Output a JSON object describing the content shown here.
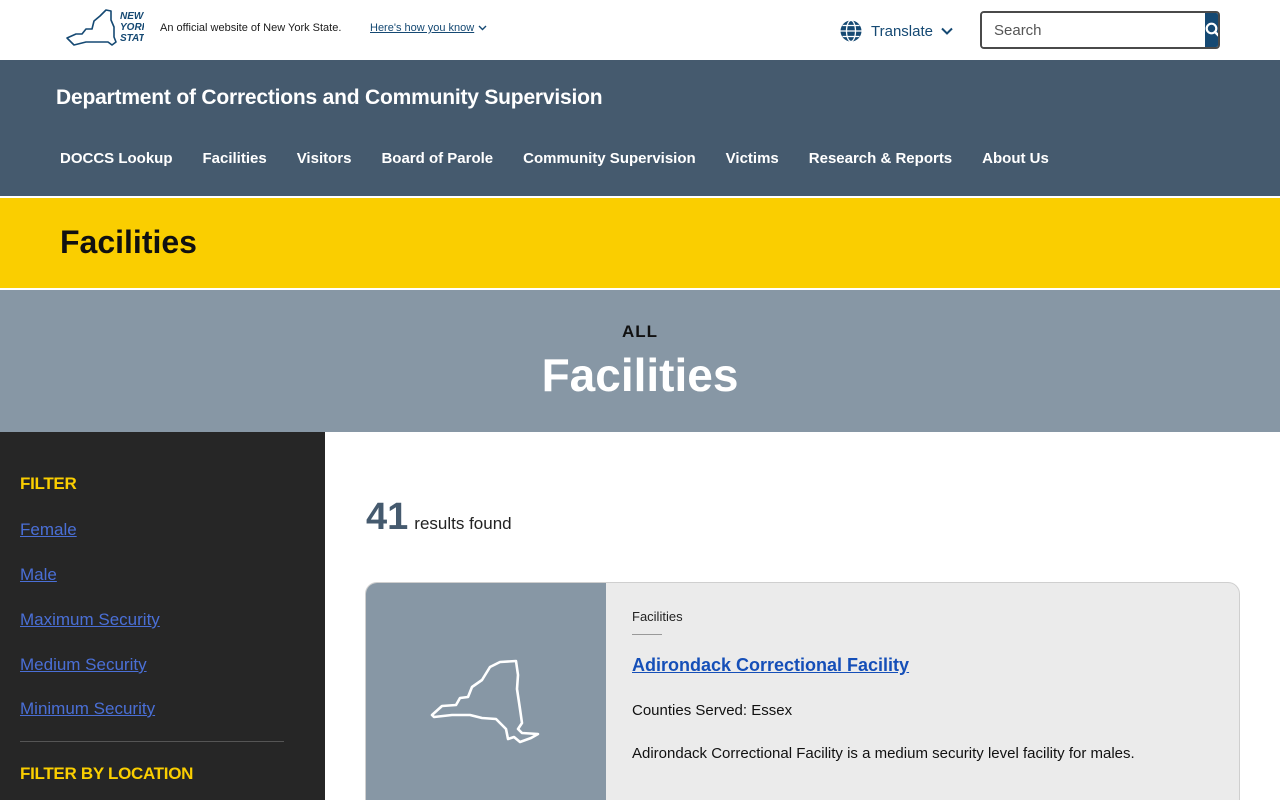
{
  "topbar": {
    "logo_text": [
      "NEW",
      "YORK",
      "STATE"
    ],
    "official_text": "An official website of New York State.",
    "how_know": "Here's how you know",
    "translate": "Translate",
    "search_placeholder": "Search"
  },
  "agency": {
    "title": "Department of Corrections and Community Supervision",
    "nav": [
      "DOCCS Lookup",
      "Facilities",
      "Visitors",
      "Board of Parole",
      "Community Supervision",
      "Victims",
      "Research & Reports",
      "About Us"
    ]
  },
  "banner": {
    "title": "Facilities"
  },
  "hero": {
    "eyebrow": "ALL",
    "title": "Facilities"
  },
  "sidebar": {
    "filter_heading": "FILTER",
    "filters": [
      "Female",
      "Male",
      "Maximum Security",
      "Medium Security",
      "Minimum Security"
    ],
    "location_heading": "FILTER BY LOCATION"
  },
  "results": {
    "count": "41",
    "label": "results found"
  },
  "card": {
    "tag": "Facilities",
    "title": "Adirondack Correctional Facility",
    "counties": "Counties Served:  Essex",
    "description": "Adirondack Correctional Facility is a medium security level facility for males."
  },
  "colors": {
    "brand_blue": "#154973",
    "agency_bg": "#455a6e",
    "banner_yellow": "#face00",
    "hero_bg": "#8797a5",
    "sidebar_bg": "#262626"
  }
}
